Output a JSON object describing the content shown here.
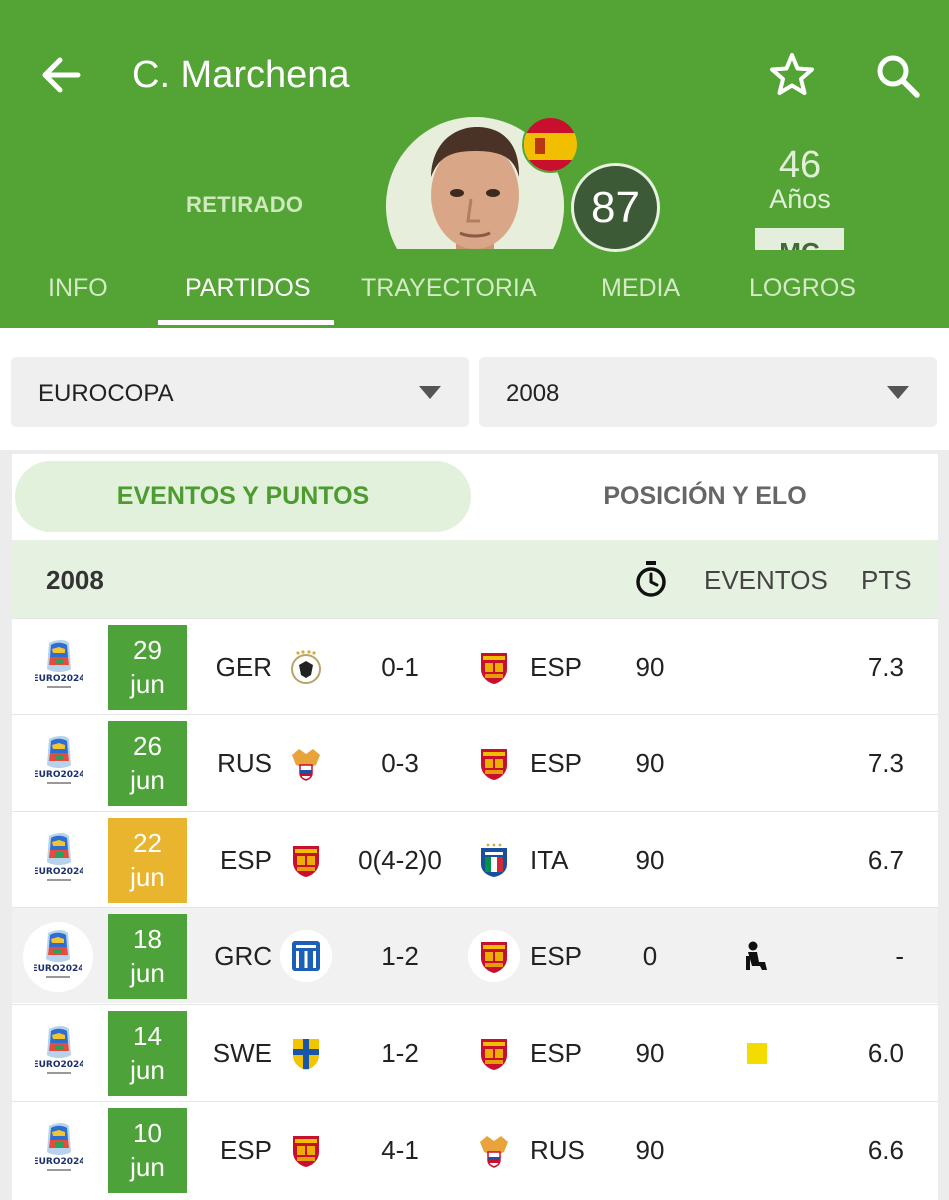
{
  "header": {
    "title": "C. Marchena",
    "status": "RETIRADO",
    "rating": "87",
    "age_value": "46",
    "age_label": "Años",
    "position_chip": "MC",
    "icons": {
      "back": "arrow-left-icon",
      "favorite": "star-outline-icon",
      "search": "search-icon"
    },
    "colors": {
      "primary": "#53a435",
      "rating_bg": "#3c5a35"
    }
  },
  "tabs": [
    {
      "label": "INFO",
      "active": false
    },
    {
      "label": "PARTIDOS",
      "active": true
    },
    {
      "label": "TRAYECTORIA",
      "active": false
    },
    {
      "label": "MEDIA",
      "active": false
    },
    {
      "label": "LOGROS",
      "active": false
    }
  ],
  "filters": {
    "competition": "EUROCOPA",
    "season": "2008"
  },
  "segments": {
    "active": "EVENTOS Y PUNTOS",
    "inactive": "POSICIÓN Y ELO"
  },
  "table": {
    "year": "2008",
    "col_events": "EVENTOS",
    "col_pts": "PTS",
    "rows": [
      {
        "day": "29",
        "month": "jun",
        "home": "GER",
        "score": "0-1",
        "away": "ESP",
        "minutes": "90",
        "event": "",
        "pts": "7.3",
        "result": "win"
      },
      {
        "day": "26",
        "month": "jun",
        "home": "RUS",
        "score": "0-3",
        "away": "ESP",
        "minutes": "90",
        "event": "",
        "pts": "7.3",
        "result": "win"
      },
      {
        "day": "22",
        "month": "jun",
        "home": "ESP",
        "score": "0(4-2)0",
        "away": "ITA",
        "minutes": "90",
        "event": "",
        "pts": "6.7",
        "result": "draw"
      },
      {
        "day": "18",
        "month": "jun",
        "home": "GRC",
        "score": "1-2",
        "away": "ESP",
        "minutes": "0",
        "event": "bench-icon",
        "pts": "-",
        "result": "win"
      },
      {
        "day": "14",
        "month": "jun",
        "home": "SWE",
        "score": "1-2",
        "away": "ESP",
        "minutes": "90",
        "event": "yellow-card-icon",
        "pts": "6.0",
        "result": "win"
      },
      {
        "day": "10",
        "month": "jun",
        "home": "ESP",
        "score": "4-1",
        "away": "RUS",
        "minutes": "90",
        "event": "",
        "pts": "6.6",
        "result": "win"
      }
    ]
  }
}
